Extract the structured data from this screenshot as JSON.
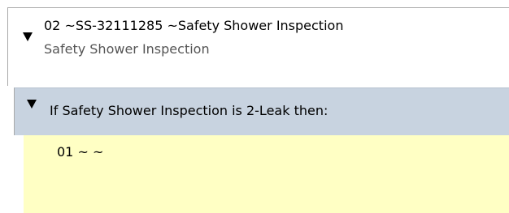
{
  "task": {
    "title": "02 ~SS-32111285 ~Safety Shower Inspection",
    "subtitle": "Safety Shower Inspection",
    "expand_icon": "triangle-down-icon"
  },
  "condition": {
    "text": "If Safety Shower Inspection is 2-Leak then:",
    "expand_icon": "triangle-down-icon",
    "header_color": "#c8d3e0"
  },
  "step": {
    "label": "01 ~ ~",
    "background_color": "#ffffc4"
  }
}
